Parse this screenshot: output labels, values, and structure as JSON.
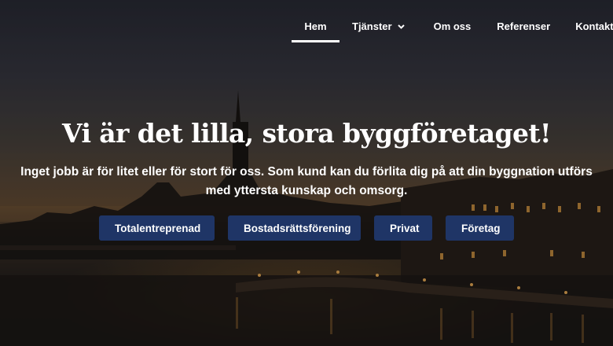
{
  "nav": {
    "items": [
      {
        "label": "Hem",
        "active": true
      },
      {
        "label": "Tjänster",
        "has_dropdown": true
      },
      {
        "label": "Om oss"
      },
      {
        "label": "Referenser"
      },
      {
        "label": "Kontakta"
      }
    ]
  },
  "hero": {
    "title": "Vi är det lilla, stora byggföretaget!",
    "text": "Inget jobb är för litet eller för stort för oss. Som kund kan du förlita dig på att din byggnation utförs med yttersta kunskap och omsorg.",
    "buttons": [
      {
        "label": "Totalentreprenad"
      },
      {
        "label": "Bostadsrättsförening"
      },
      {
        "label": "Privat"
      },
      {
        "label": "Företag"
      }
    ]
  },
  "colors": {
    "button_bg": "#1f3566",
    "text": "#ffffff"
  }
}
